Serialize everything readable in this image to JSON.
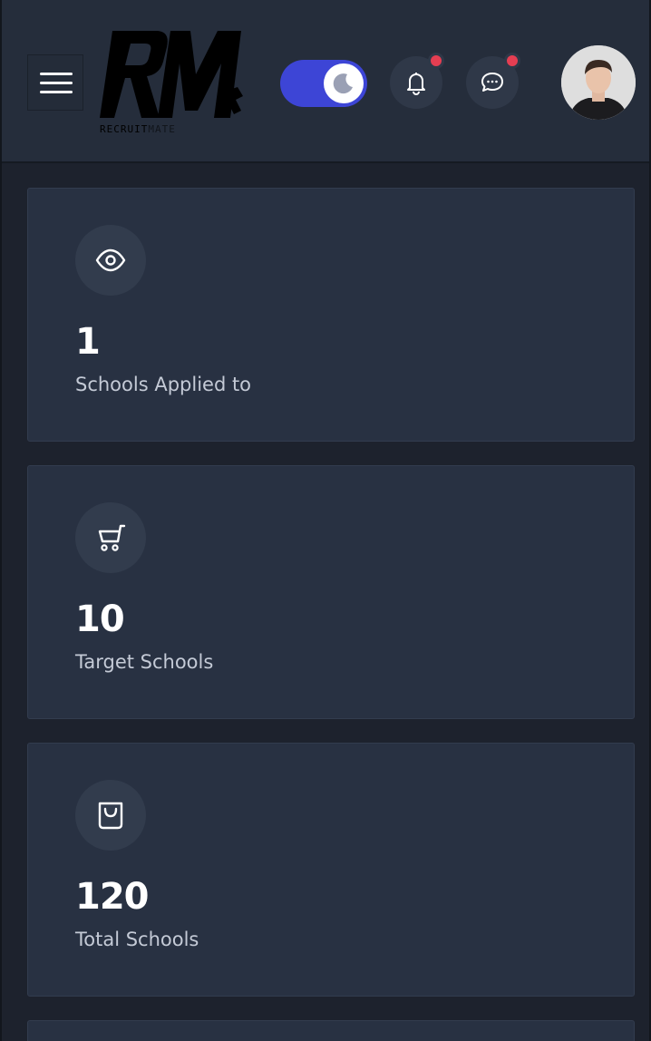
{
  "header": {
    "logo_text": "RM",
    "logo_caption_a": "RECRUIT",
    "logo_caption_b": "MATE",
    "theme_toggle": {
      "state": "dark",
      "icon": "moon-icon"
    },
    "notifications": {
      "icon": "bell-icon",
      "has_unread": true
    },
    "messages": {
      "icon": "chat-icon",
      "has_unread": true
    },
    "accent_color": "#3d45d6",
    "badge_color": "#e53e52"
  },
  "stats": [
    {
      "icon": "eye-icon",
      "value": "1",
      "label": "Schools Applied to"
    },
    {
      "icon": "cart-icon",
      "value": "10",
      "label": "Target Schools"
    },
    {
      "icon": "shopping-bag-icon",
      "value": "120",
      "label": "Total Schools"
    }
  ]
}
